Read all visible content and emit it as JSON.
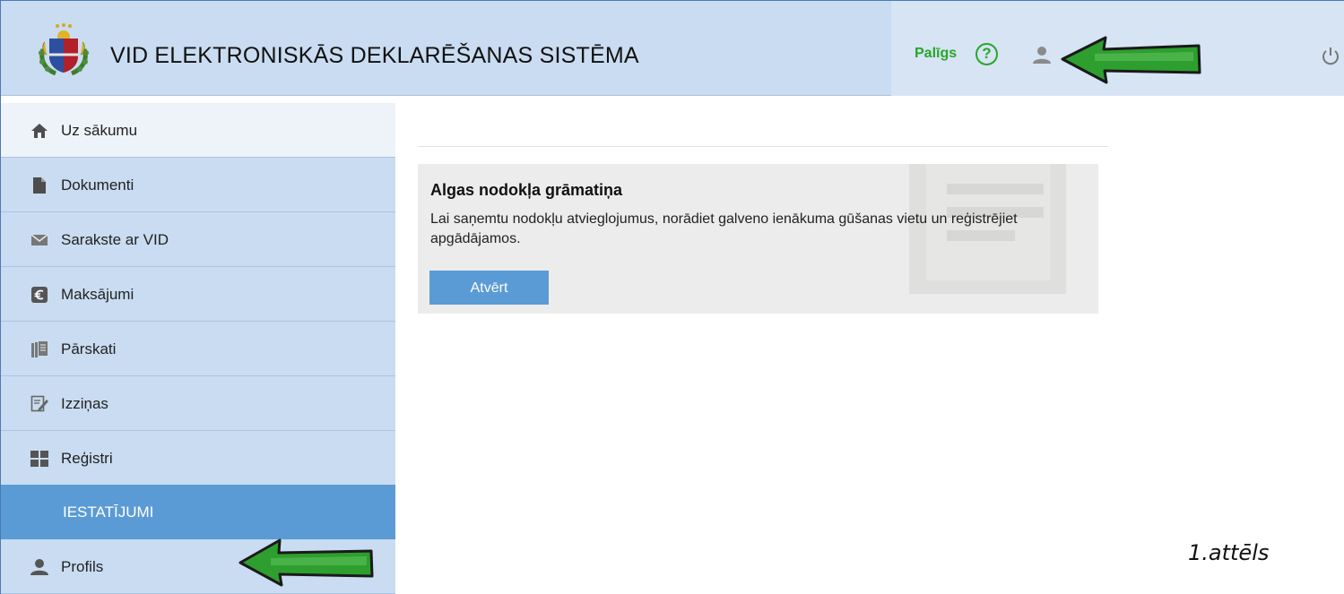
{
  "header": {
    "title": "VID ELEKTRONISKĀS DEKLARĒŠANAS SISTĒMA",
    "help_label": "Palīgs",
    "help_icon_glyph": "?",
    "icons": [
      "coat-of-arms-logo",
      "help-icon",
      "user-icon",
      "power-icon"
    ],
    "annotation_arrow_color": "#2e9e2e"
  },
  "sidebar": {
    "items": [
      {
        "label": "Uz sākumu",
        "icon": "home-icon"
      },
      {
        "label": "Dokumenti",
        "icon": "document-icon"
      },
      {
        "label": "Sarakste ar VID",
        "icon": "envelope-icon"
      },
      {
        "label": "Maksājumi",
        "icon": "euro-icon"
      },
      {
        "label": "Pārskati",
        "icon": "reports-icon"
      },
      {
        "label": "Izziņas",
        "icon": "certificate-icon"
      },
      {
        "label": "Reģistri",
        "icon": "registers-icon"
      }
    ],
    "section_label": "IESTATĪJUMI",
    "section_items": [
      {
        "label": "Profils",
        "icon": "user-icon"
      }
    ]
  },
  "main": {
    "card": {
      "title": "Algas nodokļa grāmatiņa",
      "description": "Lai saņemtu nodokļu atvieglojumus, norādiet galveno ienākuma gūšanas vietu un reģistrējiet apgādājamos.",
      "button_label": "Atvērt"
    }
  },
  "caption": "1.attēls",
  "colors": {
    "header_bg": "#c9dcf1",
    "sidebar_bg": "#c9dcf1",
    "accent": "#5b9bd5",
    "help_green": "#2aa52a",
    "card_bg": "#ececec"
  }
}
